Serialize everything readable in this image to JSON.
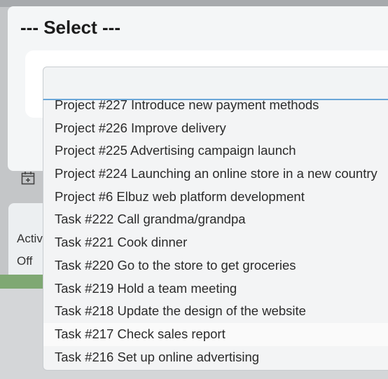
{
  "modal": {
    "title": "--- Select ---"
  },
  "search": {
    "value": "",
    "placeholder": ""
  },
  "options": [
    "Project #227 Introduce new payment methods",
    "Project #226 Improve delivery",
    "Project #225 Advertising campaign launch",
    "Project #224 Launching an online store in a new country",
    "Project #6 Elbuz web platform development",
    "Task #222 Call grandma/grandpa",
    "Task #221 Cook dinner",
    "Task #220 Go to the store to get groceries",
    "Task #219 Hold a team meeting",
    "Task #218 Update the design of the website",
    "Task #217 Check sales report",
    "Task #216 Set up online advertising"
  ],
  "background": {
    "label_active": "Activ",
    "label_off": "Off",
    "icon": "calendar-plus-icon"
  },
  "colors": {
    "focus_underline": "#6aa7d8",
    "overlay": "#c4c6c8"
  }
}
